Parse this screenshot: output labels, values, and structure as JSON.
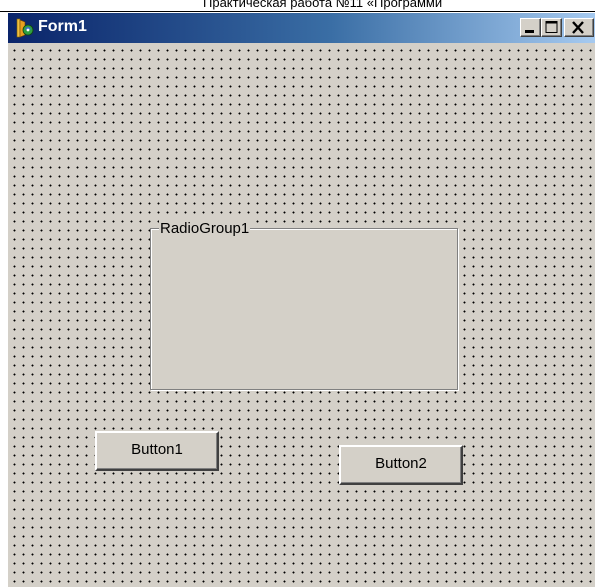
{
  "page_header": {
    "text": "Практическая работа №11 «Программи"
  },
  "window": {
    "title": "Form1",
    "icon": "delphi-form-icon",
    "controls": {
      "minimize_icon": "minimize-icon",
      "maximize_icon": "maximize-icon",
      "close_icon": "close-icon"
    }
  },
  "form": {
    "radio_group": {
      "caption": "RadioGroup1"
    },
    "buttons": [
      {
        "label": "Button1"
      },
      {
        "label": "Button2"
      }
    ]
  },
  "colors": {
    "title_bar_start": "#0a246a",
    "title_bar_end": "#a6caf0",
    "face": "#d4d0c8"
  }
}
